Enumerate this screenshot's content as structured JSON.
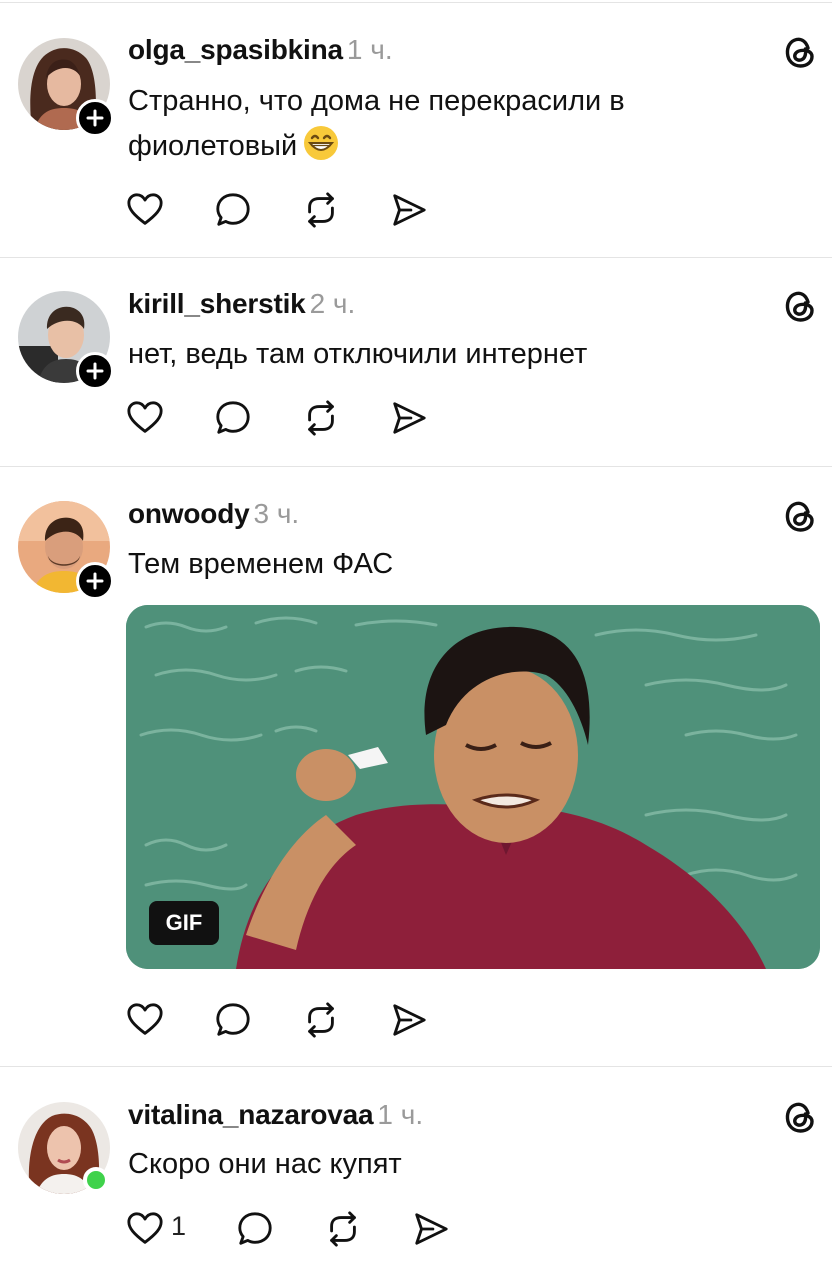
{
  "posts": [
    {
      "username": "olga_spasibkina",
      "time": "1 ч.",
      "text_line1": "Странно, что дома не перекрасили в",
      "text_line2": "фиолетовый",
      "emoji": "grinning-face",
      "avatar_badge": "follow-plus",
      "like_count": ""
    },
    {
      "username": "kirill_sherstik",
      "time": "2 ч.",
      "text": "нет, ведь там отключили интернет",
      "avatar_badge": "follow-plus",
      "like_count": ""
    },
    {
      "username": "onwoody",
      "time": "3 ч.",
      "text": "Тем временем ФАС",
      "media_label": "GIF",
      "avatar_badge": "follow-plus",
      "like_count": ""
    },
    {
      "username": "vitalina_nazarovaa",
      "time": "1 ч.",
      "text": "Скоро они нас купят",
      "avatar_badge": "online-dot",
      "like_count": "1"
    }
  ],
  "icons": {
    "like": "heart-icon",
    "reply": "comment-icon",
    "repost": "repost-icon",
    "share": "send-icon",
    "menu": "threads-logo-icon"
  },
  "colors": {
    "text": "#111111",
    "secondary": "#9a9a9a",
    "divider": "#e4e4e4",
    "online": "#3fd24b"
  }
}
